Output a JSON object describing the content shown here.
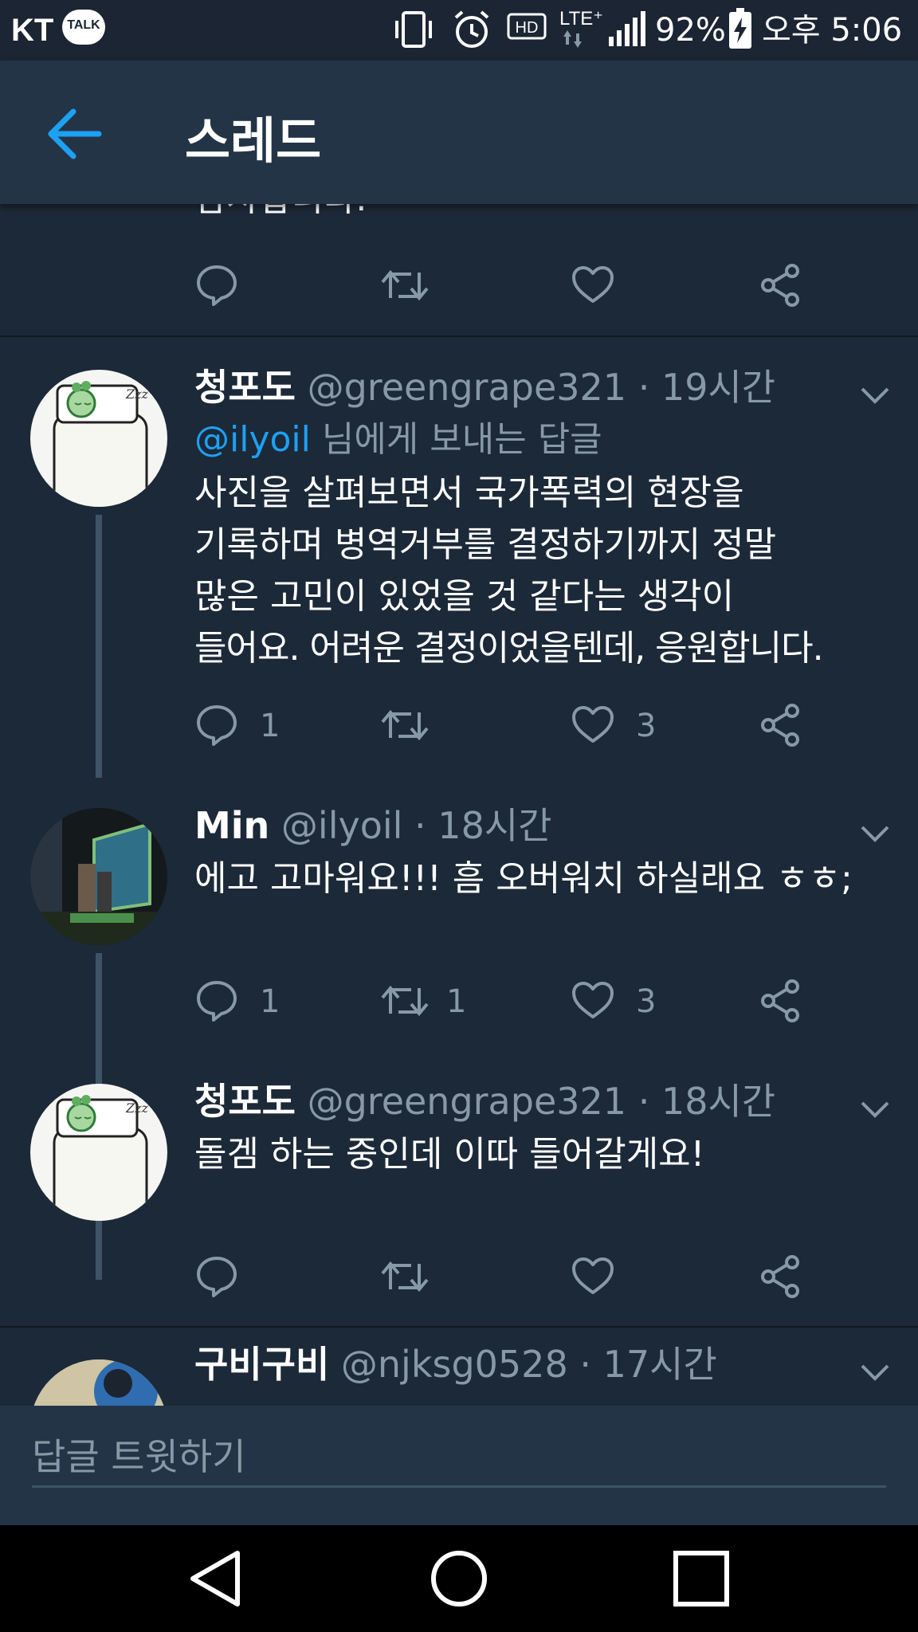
{
  "status_bar": {
    "carrier": "KT",
    "talk_badge": "TALK",
    "network": "LTE⁺",
    "battery": "92%",
    "time": "오후 5:06"
  },
  "header": {
    "title": "스레드"
  },
  "previous_tweet_tail": "감사합니다.",
  "tweets": [
    {
      "name": "청포도",
      "handle": "@greengrape321",
      "time": "19시간",
      "reply_to_mention": "@ilyoil",
      "reply_to_suffix": " 님에게 보내는 답글",
      "text_lines": [
        "사진을 살펴보면서 국가폭력의 현장을",
        "기록하며 병역거부를 결정하기까지 정말",
        "많은 고민이 있었을 것 같다는 생각이",
        "들어요. 어려운 결정이었을텐데, 응원합니다."
      ],
      "reply_count": "1",
      "retweet_count": "",
      "like_count": "3"
    },
    {
      "name": "Min",
      "handle": "@ilyoil",
      "time": "18시간",
      "text_lines": [
        "에고 고마워요!!! 흠 오버워치 하실래요 ㅎㅎ;"
      ],
      "reply_count": "1",
      "retweet_count": "1",
      "like_count": "3"
    },
    {
      "name": "청포도",
      "handle": "@greengrape321",
      "time": "18시간",
      "text_lines": [
        "돌겜 하는 중인데 이따 들어갈게요!"
      ],
      "reply_count": "",
      "retweet_count": "",
      "like_count": ""
    },
    {
      "name": "구비구비",
      "handle": "@njksg0528",
      "time": "17시간"
    }
  ],
  "compose": {
    "placeholder": "답글 트윗하기"
  },
  "colors": {
    "background": "#1c2938",
    "appbar": "#243447",
    "accent": "#1da1f2",
    "muted": "#8899a6"
  },
  "icons": [
    "back-arrow-icon",
    "reply-icon",
    "retweet-icon",
    "like-icon",
    "share-icon",
    "chevron-down-icon"
  ]
}
